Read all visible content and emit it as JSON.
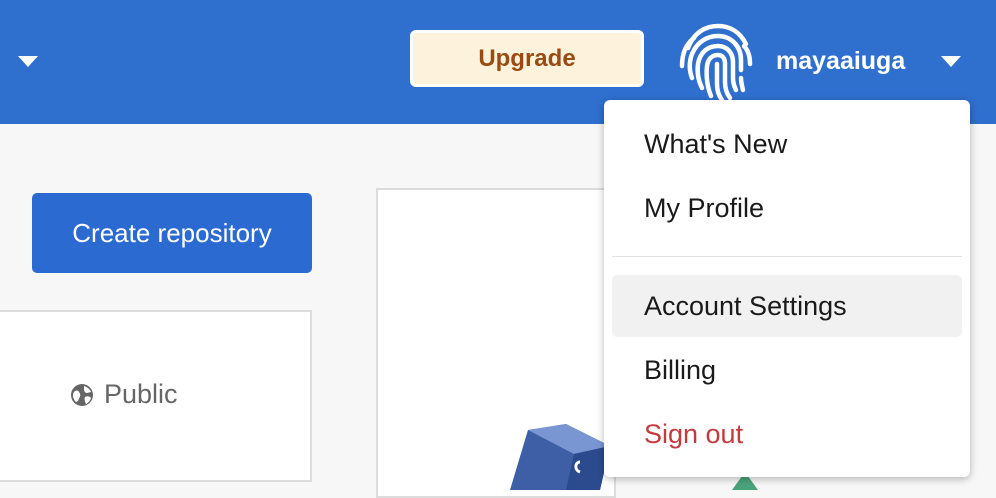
{
  "header": {
    "upgrade_label": "Upgrade",
    "username": "mayaaiuga"
  },
  "main": {
    "create_repository_label": "Create repository",
    "visibility_label": "Public"
  },
  "user_menu": {
    "items": [
      {
        "label": "What's New"
      },
      {
        "label": "My Profile"
      },
      {
        "label": "Account Settings"
      },
      {
        "label": "Billing"
      },
      {
        "label": "Sign out"
      }
    ]
  },
  "colors": {
    "header_bg": "#2f6fce",
    "primary_button": "#2b6bd1",
    "upgrade_bg": "#fdf3dc",
    "upgrade_text": "#9a4a12",
    "danger": "#c43a3e"
  },
  "icons": {
    "avatar": "fingerprint-icon",
    "visibility": "globe-icon",
    "menu_toggle": "chevron-down-icon"
  }
}
